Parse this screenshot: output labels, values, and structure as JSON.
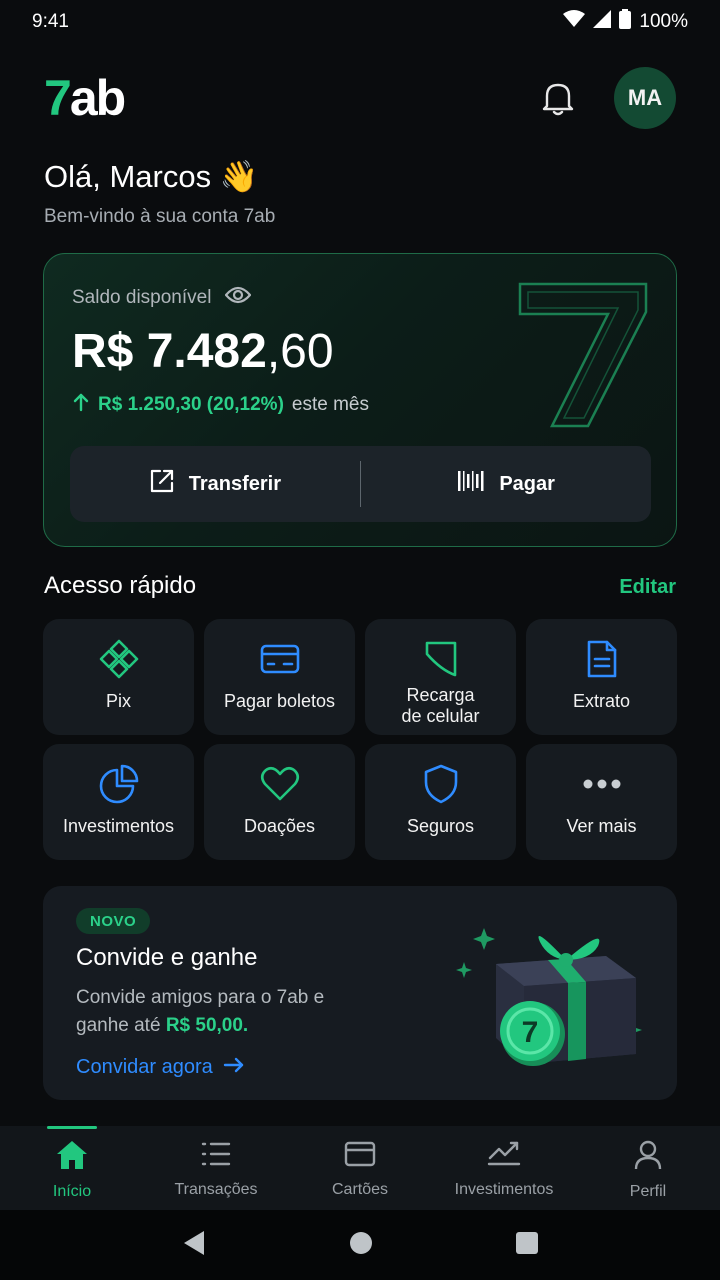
{
  "status_bar": {
    "time": "9:41",
    "battery": "100%"
  },
  "header": {
    "logo": "7ab",
    "avatar_initials": "MA"
  },
  "greeting": {
    "title": "Olá, Marcos 👋",
    "subtitle": "Bem-vindo à sua conta 7ab"
  },
  "balance": {
    "label": "Saldo disponível",
    "amount_int": "R$ 7.482",
    "amount_cents": ",60",
    "change_value": "R$ 1.250,30 (20,12%)",
    "change_suffix": "este mês",
    "actions": [
      {
        "label": "Transferir",
        "icon": "transfer-icon"
      },
      {
        "label": "Pagar",
        "icon": "barcode-icon"
      }
    ]
  },
  "quick_access": {
    "title": "Acesso rápido",
    "edit": "Editar",
    "items": [
      {
        "label": "Pix",
        "icon": "pix-icon"
      },
      {
        "label": "Pagar boletos",
        "icon": "card-icon"
      },
      {
        "label_line1": "Recarga",
        "label_line2": "de celular",
        "icon": "phone-recharge-icon"
      },
      {
        "label": "Extrato",
        "icon": "document-icon"
      },
      {
        "label": "Investimentos",
        "icon": "pie-chart-icon"
      },
      {
        "label": "Doações",
        "icon": "heart-icon"
      },
      {
        "label": "Seguros",
        "icon": "shield-icon"
      },
      {
        "label": "Ver mais",
        "icon": "more-icon"
      }
    ]
  },
  "promo": {
    "badge": "NOVO",
    "title": "Convide e ganhe",
    "text_before": "Convide amigos para o 7ab e ganhe até ",
    "text_highlight": "R$ 50,00.",
    "link": "Convidar agora",
    "coin_label": "7"
  },
  "bottom_nav": [
    {
      "label": "Início",
      "icon": "home-icon",
      "active": true
    },
    {
      "label": "Transações",
      "icon": "list-icon",
      "active": false
    },
    {
      "label": "Cartões",
      "icon": "card-icon",
      "active": false
    },
    {
      "label": "Investimentos",
      "icon": "chart-icon",
      "active": false
    },
    {
      "label": "Perfil",
      "icon": "user-icon",
      "active": false
    }
  ],
  "colors": {
    "accent": "#22c77f",
    "link": "#2f8cff",
    "background": "#0a0c0e",
    "tile": "#161b20"
  }
}
